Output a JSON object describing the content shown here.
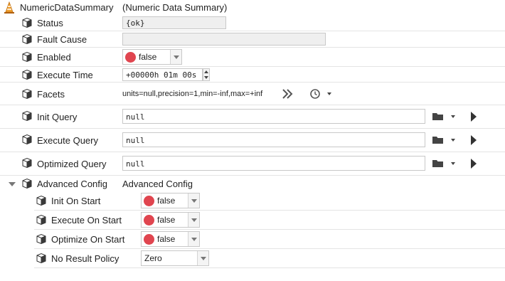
{
  "header": {
    "title": "NumericDataSummary",
    "subtitle": "(Numeric Data Summary)"
  },
  "rows": {
    "status": {
      "label": "Status",
      "value": "{ok}"
    },
    "fault_cause": {
      "label": "Fault Cause",
      "value": ""
    },
    "enabled": {
      "label": "Enabled",
      "value": "false"
    },
    "execute_time": {
      "label": "Execute Time",
      "value": "+00000h 01m 00s"
    },
    "facets": {
      "label": "Facets",
      "value": "units=null,precision=1,min=-inf,max=+inf"
    },
    "init_query": {
      "label": "Init Query",
      "value": "null"
    },
    "execute_query": {
      "label": "Execute Query",
      "value": "null"
    },
    "optimized_query": {
      "label": "Optimized Query",
      "value": "null"
    },
    "advanced_config": {
      "label": "Advanced Config",
      "value": "Advanced Config"
    }
  },
  "advanced": {
    "init_on_start": {
      "label": "Init On Start",
      "value": "false"
    },
    "execute_on_start": {
      "label": "Execute On Start",
      "value": "false"
    },
    "optimize_on_start": {
      "label": "Optimize On Start",
      "value": "false"
    },
    "no_result_policy": {
      "label": "No Result Policy",
      "value": "Zero"
    }
  },
  "colors": {
    "false_dot": "#e0454f",
    "cone_orange": "#f0a030"
  },
  "icons": {
    "header": "traffic-cone-icon",
    "slot": "cube-icon",
    "folder": "folder-icon",
    "clock": "clock-icon",
    "expand": "double-chevron-right-icon",
    "run": "play-icon"
  }
}
